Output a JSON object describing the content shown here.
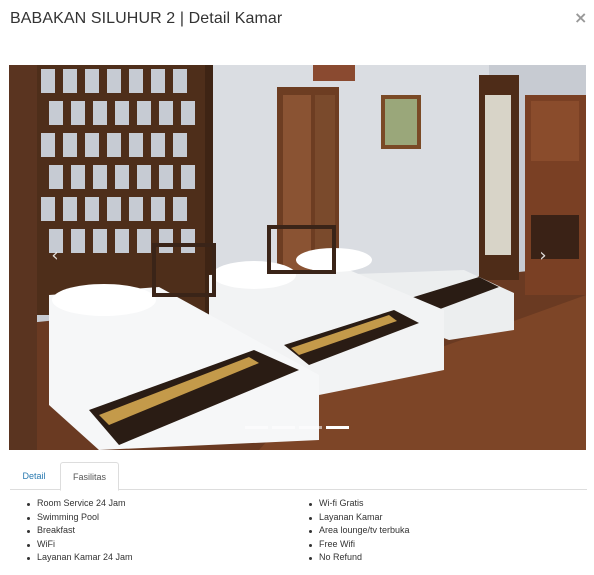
{
  "modal": {
    "title": "BABAKAN SILUHUR 2 | Detail Kamar",
    "close_symbol": "×"
  },
  "carousel": {
    "prev_icon": "chevron-left-icon",
    "next_icon": "chevron-right-icon",
    "prev_symbol": "‹",
    "next_symbol": "›",
    "slide_count": 4,
    "active_index": 3
  },
  "tabs": [
    {
      "label": "Detail",
      "active": false
    },
    {
      "label": "Fasilitas",
      "active": true
    }
  ],
  "facilities": {
    "left": [
      "Room Service 24 Jam",
      "Swimming Pool",
      "Breakfast",
      "WiFi",
      "Layanan Kamar 24 Jam"
    ],
    "right": [
      "Wi-fi Gratis",
      "Layanan Kamar",
      "Area lounge/tv terbuka",
      "Free Wifi",
      "No Refund"
    ]
  },
  "colors": {
    "link": "#2a7ab0",
    "border": "#dddddd",
    "text": "#333333"
  }
}
